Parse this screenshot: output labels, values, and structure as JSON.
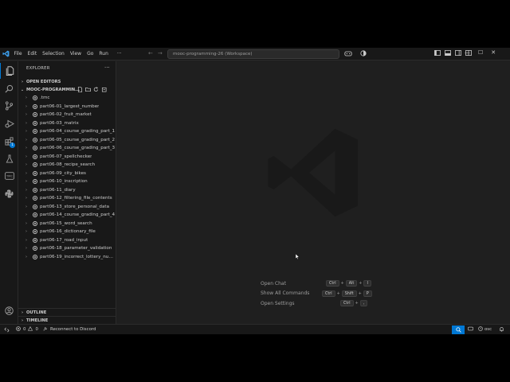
{
  "titlebar": {
    "menus": [
      "File",
      "Edit",
      "Selection",
      "View",
      "Go",
      "Run"
    ],
    "more": "···",
    "command_center": "mooc-programming-26 (Workspace)"
  },
  "activity": {
    "badge_count": "1",
    "tmc_label": "TMC"
  },
  "sidebar": {
    "title": "EXPLORER",
    "more": "···",
    "open_editors": "OPEN EDITORS",
    "workspace": "MOOC-PROGRAMMIN...",
    "items": [
      ".tmc",
      "part06-01_largest_number",
      "part06-02_fruit_market",
      "part06-03_matrix",
      "part06-04_course_grading_part_1",
      "part06-05_course_grading_part_2",
      "part06-06_course_grading_part_3",
      "part06-07_spellchecker",
      "part06-08_recipe_search",
      "part06-09_city_bikes",
      "part06-10_inscription",
      "part06-11_diary",
      "part06-12_filtering_file_contents",
      "part06-13_store_personal_data",
      "part06-14_course_grading_part_4",
      "part06-15_word_search",
      "part06-16_dictionary_file",
      "part06-17_road_input",
      "part06-18_parameter_validation",
      "part06-19_incorrect_lottery_num..."
    ],
    "outline": "OUTLINE",
    "timeline": "TIMELINE"
  },
  "editor": {
    "shortcuts": [
      {
        "label": "Open Chat",
        "keys": [
          "Ctrl",
          "Alt",
          "I"
        ]
      },
      {
        "label": "Show All Commands",
        "keys": [
          "Ctrl",
          "Shift",
          "P"
        ]
      },
      {
        "label": "Open Settings",
        "keys": [
          "Ctrl",
          ","
        ]
      }
    ]
  },
  "statusbar": {
    "errors": "0",
    "warnings": "0",
    "discord": "Reconnect to Discord",
    "timer": "osc"
  },
  "colors": {
    "accent": "#0078d4",
    "background": "#1f1f1f",
    "sidebar": "#181818"
  }
}
